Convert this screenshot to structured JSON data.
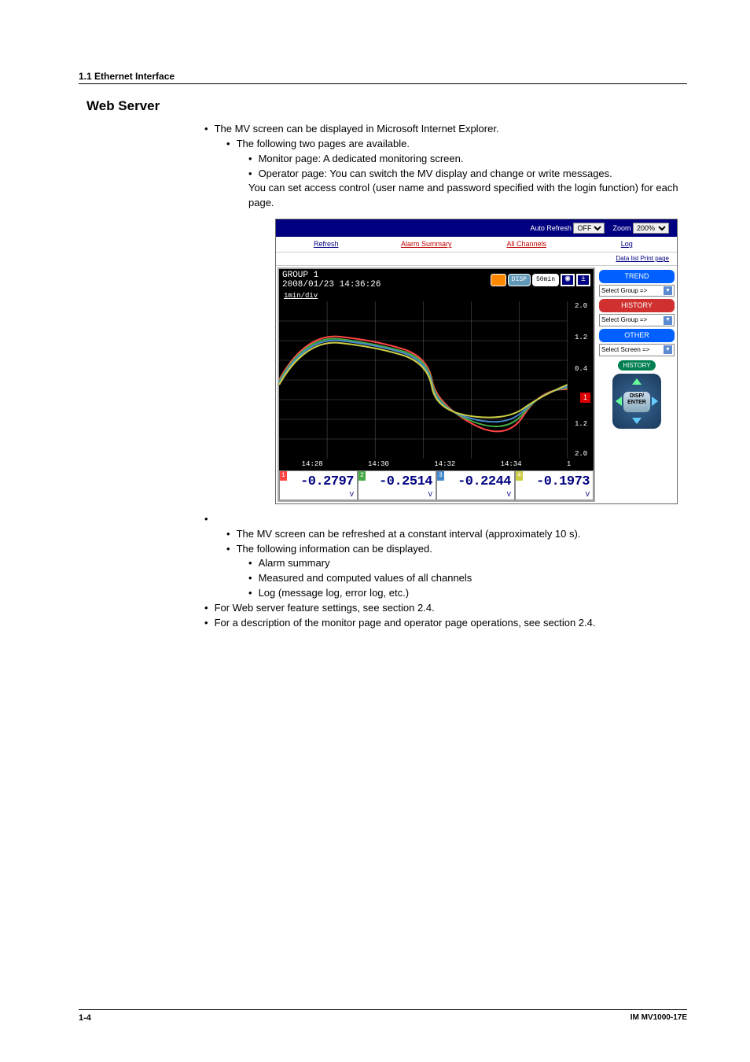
{
  "header": {
    "section": "1.1  Ethernet Interface",
    "title": "Web Server"
  },
  "text": {
    "p1": "The MV screen can be displayed in Microsoft Internet Explorer.",
    "p2": "The following two pages are available.",
    "p3": "Monitor page: A dedicated monitoring screen.",
    "p4": "Operator page: You can switch the MV display and change or write messages.",
    "p5": "You can set access control (user name and password specified with the login function) for each page.",
    "p6": "The MV screen can be refreshed at a constant interval (approximately 10 s).",
    "p7": "The following information can be displayed.",
    "p8": "Alarm summary",
    "p9": "Measured and computed values of all channels",
    "p10": "Log (message log, error log, etc.)",
    "p11": "For Web server feature settings, see section 2.4.",
    "p12": "For a description of the monitor page and operator page operations, see section 2.4."
  },
  "screenshot": {
    "topbar": {
      "auto_refresh_label": "Auto Refresh",
      "auto_refresh_value": "OFF",
      "zoom_label": "Zoom",
      "zoom_value": "200%"
    },
    "nav": {
      "refresh": "Refresh",
      "alarm": "Alarm Summary",
      "channels": "All Channels",
      "log": "Log",
      "print": "Data list Print page"
    },
    "group_head": {
      "title": "GROUP 1",
      "timestamp": "2008/01/23 14:36:26",
      "mindiv": "1min/div",
      "disp": "DISP",
      "rate": "50min"
    },
    "time_labels": [
      "14:28",
      "14:30",
      "14:32",
      "14:34"
    ],
    "time_edge": "1",
    "scale": {
      "v0": "2.0",
      "v1": "1.2",
      "v2": "0.4",
      "v3": "1.2",
      "v4": "2.0",
      "marker": "1"
    },
    "digital": [
      {
        "n": "1",
        "val": "-0.2797",
        "unit": "V"
      },
      {
        "n": "2",
        "val": "-0.2514",
        "unit": "V"
      },
      {
        "n": "3",
        "val": "-0.2244",
        "unit": "V"
      },
      {
        "n": "4",
        "val": "-0.1973",
        "unit": "V"
      }
    ],
    "side": {
      "trend": "TREND",
      "history": "HISTORY",
      "other": "OTHER",
      "select_group": "Select Group =>",
      "select_screen": "Select Screen =>",
      "history_pill": "HISTORY",
      "disp_enter": "DISP/\nENTER"
    }
  },
  "chart_data": {
    "type": "line",
    "title": "GROUP 1",
    "xlabel": "",
    "ylabel": "",
    "ylim": [
      -2.0,
      2.0
    ],
    "x_ticks": [
      "14:28",
      "14:30",
      "14:32",
      "14:34"
    ],
    "series": [
      {
        "name": "Ch1",
        "color": "#ff4444",
        "last_value": -0.2797,
        "unit": "V"
      },
      {
        "name": "Ch2",
        "color": "#44aa44",
        "last_value": -0.2514,
        "unit": "V"
      },
      {
        "name": "Ch3",
        "color": "#4488cc",
        "last_value": -0.2244,
        "unit": "V"
      },
      {
        "name": "Ch4",
        "color": "#cccc44",
        "last_value": -0.1973,
        "unit": "V"
      }
    ]
  },
  "footer": {
    "page": "1-4",
    "doc": "IM MV1000-17E"
  }
}
